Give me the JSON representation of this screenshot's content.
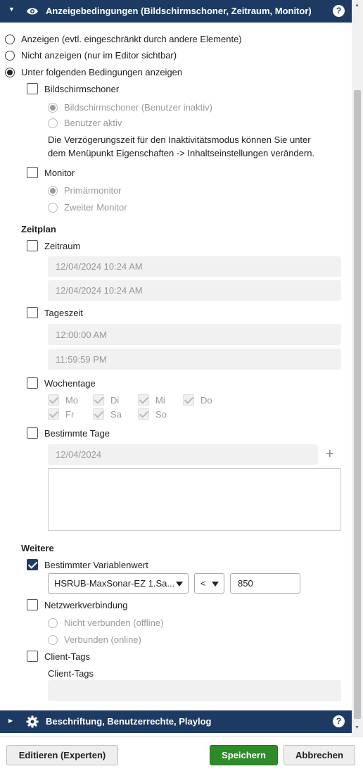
{
  "header_top": {
    "title": "Anzeigebedingungen (Bildschirmschoner, Zeitraum, Monitor)",
    "help": "?"
  },
  "display": {
    "option_show": "Anzeigen (evtl. eingeschränkt durch andere Elemente)",
    "option_hide": "Nicht anzeigen (nur im Editor sichtbar)",
    "option_conditional": "Unter folgenden Bedingungen anzeigen"
  },
  "screensaver": {
    "label": "Bildschirmschoner",
    "opt_inactive": "Bildschirmschoner (Benutzer inaktiv)",
    "opt_active": "Benutzer aktiv",
    "info_line1": "Die Verzögerungszeit für den Inaktivitätsmodus können Sie unter",
    "info_line2": "dem Menüpunkt Eigenschaften -> Inhaltseinstellungen verändern."
  },
  "monitor": {
    "label": "Monitor",
    "opt_primary": "Primärmonitor",
    "opt_second": "Zweiter Monitor"
  },
  "schedule": {
    "title": "Zeitplan",
    "period_label": "Zeitraum",
    "period_start": "12/04/2024 10:24 AM",
    "period_end": "12/04/2024 10:24 AM",
    "daytime_label": "Tageszeit",
    "daytime_start": "12:00:00 AM",
    "daytime_end": "11:59:59 PM",
    "weekdays_label": "Wochentage",
    "days": {
      "mo": "Mo",
      "di": "Di",
      "mi": "Mi",
      "do": "Do",
      "fr": "Fr",
      "sa": "Sa",
      "so": "So"
    },
    "specific_label": "Bestimmte Tage",
    "specific_date": "12/04/2024",
    "plus": "+"
  },
  "more": {
    "title": "Weitere",
    "variable_label": "Bestimmter Variablenwert",
    "variable_select": "HSRUB-MaxSonar-EZ 1.Sa...",
    "operator": "<",
    "value": "850",
    "network_label": "Netzwerkverbindung",
    "net_offline": "Nicht verbunden (offline)",
    "net_online": "Verbunden (online)",
    "clienttags_label": "Client-Tags",
    "clienttags_field_label": "Client-Tags"
  },
  "header_bottom": {
    "title": "Beschriftung, Benutzerrechte, Playlog",
    "help": "?"
  },
  "footer": {
    "edit_expert": "Editieren (Experten)",
    "save": "Speichern",
    "cancel": "Abbrechen"
  }
}
